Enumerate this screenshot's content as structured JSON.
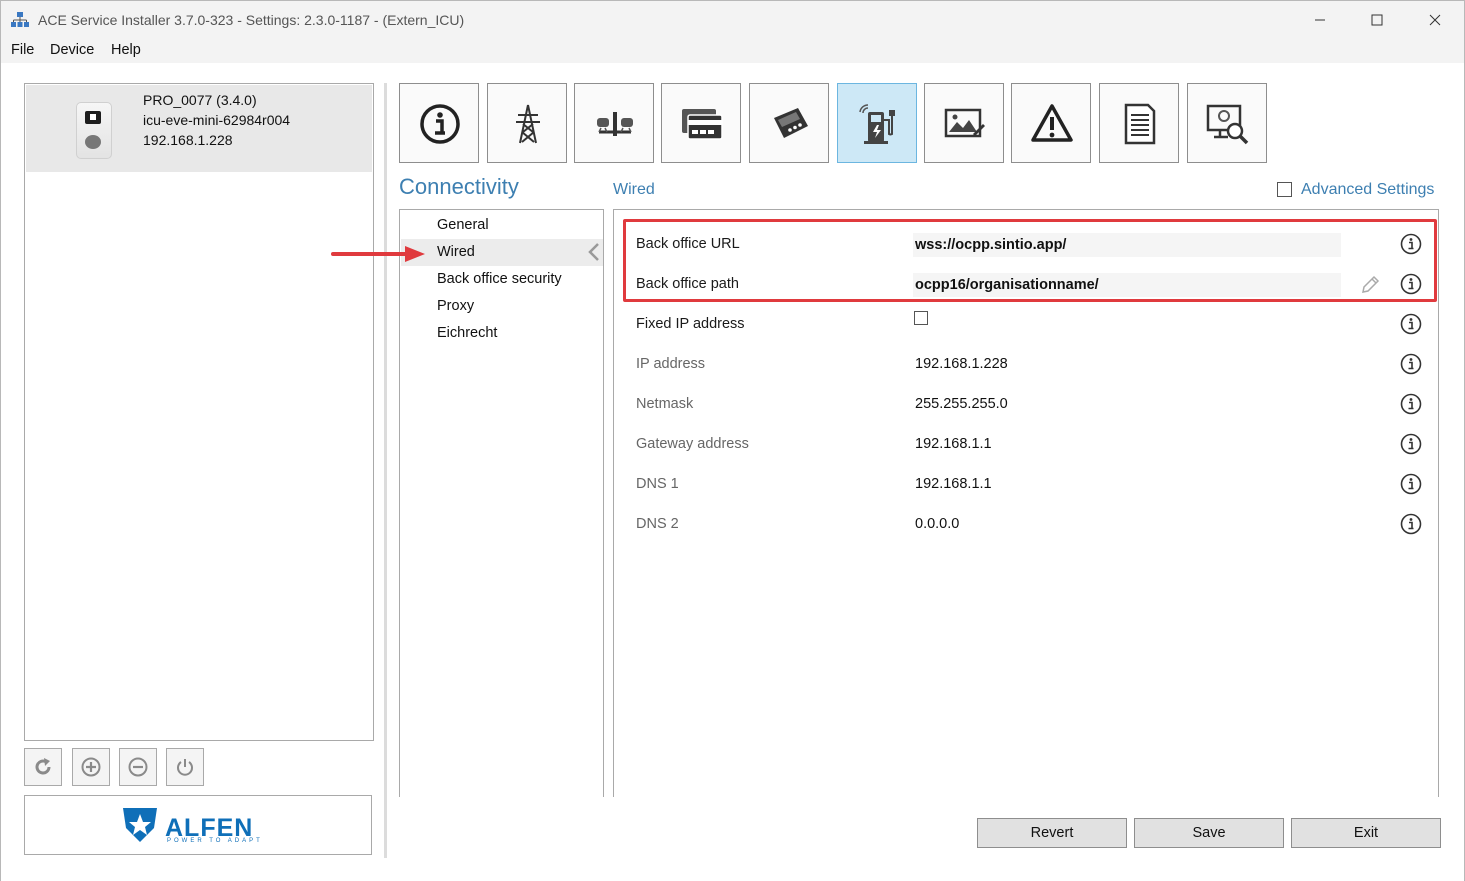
{
  "window": {
    "title": "ACE Service Installer 3.7.0-323 - Settings: 2.3.0-1187 -  (Extern_ICU)",
    "controls": [
      "minimize",
      "maximize",
      "close"
    ]
  },
  "menu": {
    "items": [
      {
        "label": "File"
      },
      {
        "label": "Device"
      },
      {
        "label": "Help"
      }
    ]
  },
  "device": {
    "name": "PRO_0077 (3.4.0)",
    "id": "icu-eve-mini-62984r004",
    "ip": "192.168.1.228"
  },
  "device_tools": [
    {
      "icon": "refresh-icon"
    },
    {
      "icon": "add-icon"
    },
    {
      "icon": "remove-icon"
    },
    {
      "icon": "power-icon"
    }
  ],
  "logo": {
    "word": "ALFEN",
    "tagline": "POWER TO ADAPT"
  },
  "toolbar": {
    "buttons": [
      {
        "icon": "info-icon",
        "active": false
      },
      {
        "icon": "power-pylon-icon",
        "active": false
      },
      {
        "icon": "balance-scale-icon",
        "active": false
      },
      {
        "icon": "payment-card-icon",
        "active": false
      },
      {
        "icon": "card-terminal-icon",
        "active": false
      },
      {
        "icon": "charger-connectivity-icon",
        "active": true
      },
      {
        "icon": "display-image-icon",
        "active": false
      },
      {
        "icon": "warning-icon",
        "active": false
      },
      {
        "icon": "document-icon",
        "active": false
      },
      {
        "icon": "monitor-search-icon",
        "active": false
      }
    ]
  },
  "section": {
    "title": "Connectivity",
    "subsection": "Wired",
    "advanced_settings_label": "Advanced Settings",
    "advanced_settings_checked": false
  },
  "nav": {
    "items": [
      {
        "label": "General",
        "selected": false
      },
      {
        "label": "Wired",
        "selected": true
      },
      {
        "label": "Back office security",
        "selected": false
      },
      {
        "label": "Proxy",
        "selected": false
      },
      {
        "label": "Eichrecht",
        "selected": false
      }
    ]
  },
  "settings": {
    "rows": [
      {
        "label": "Back office URL",
        "value": "wss://ocpp.sintio.app/",
        "editable": true
      },
      {
        "label": "Back office path",
        "value": "ocpp16/organisationname/",
        "editable": true
      },
      {
        "label": "Fixed IP address",
        "value": "",
        "checkbox": true,
        "checked": false
      },
      {
        "label": "IP address",
        "value": "192.168.1.228",
        "editable": false
      },
      {
        "label": "Netmask",
        "value": "255.255.255.0",
        "editable": false
      },
      {
        "label": "Gateway address",
        "value": "192.168.1.1",
        "editable": false
      },
      {
        "label": "DNS 1",
        "value": "192.168.1.1",
        "editable": false
      },
      {
        "label": "DNS 2",
        "value": "0.0.0.0",
        "editable": false
      }
    ]
  },
  "footer": {
    "revert_label": "Revert",
    "save_label": "Save",
    "exit_label": "Exit"
  },
  "colors": {
    "accent": "#3d7fb1",
    "highlight": "#e03a3e",
    "active_tab": "#cde8f6",
    "brand": "#0f6fb8"
  }
}
